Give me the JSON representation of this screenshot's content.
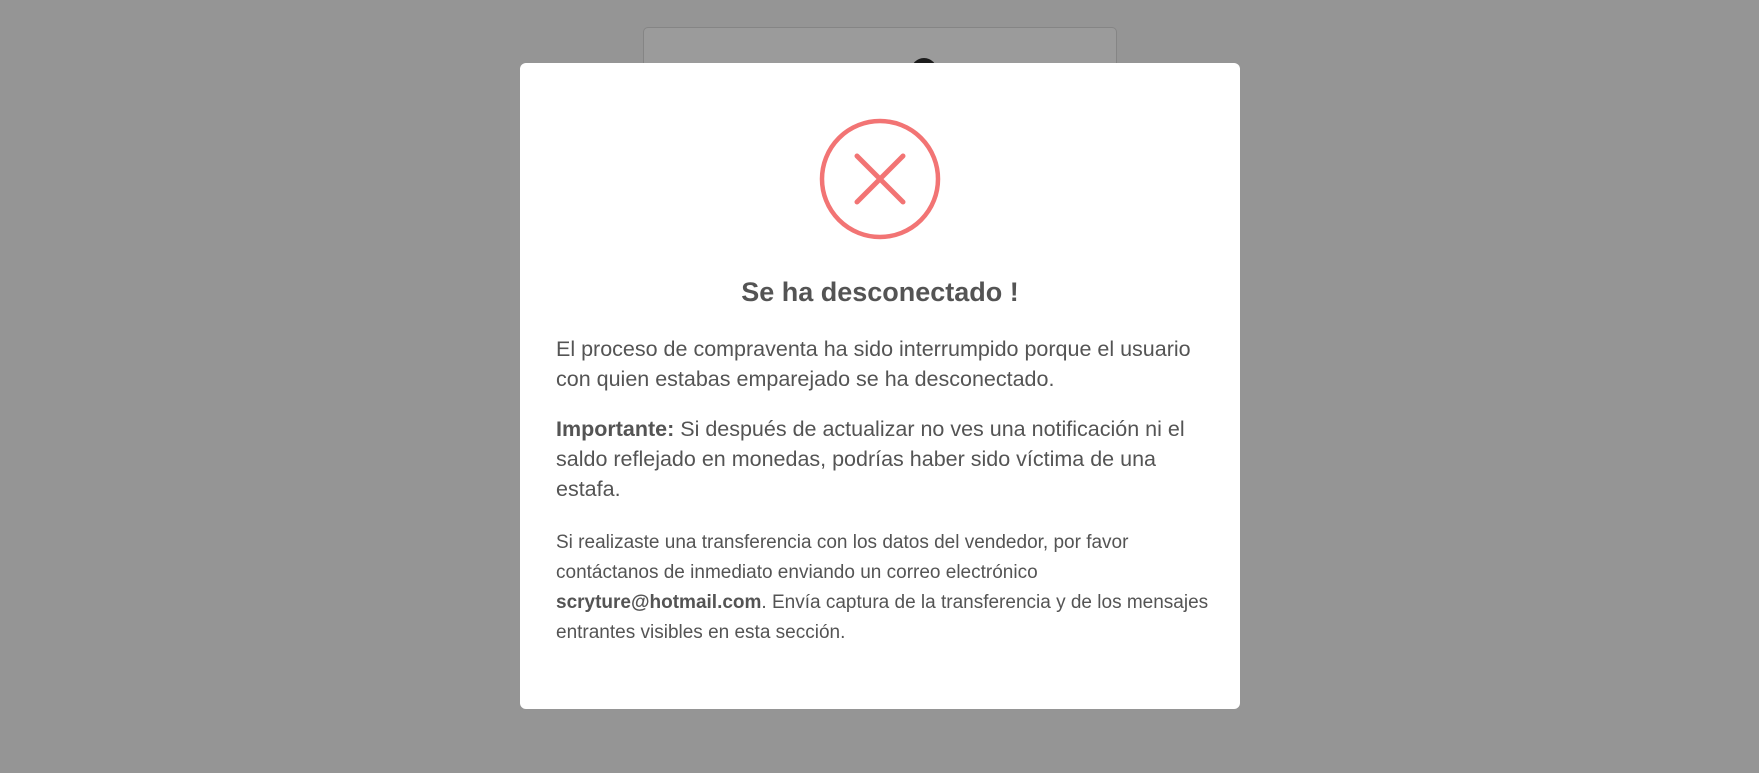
{
  "modal": {
    "icon": "error-x-icon",
    "accent_color": "#f27474",
    "title": "Se ha desconectado !",
    "message": "El proceso de compraventa ha sido interrumpido porque el usuario con quien estabas emparejado se ha desconectado.",
    "important_label": "Importante:",
    "important_text": " Si después de actualizar no ves una notificación ni el saldo reflejado en monedas, podrías haber sido víctima de una estafa.",
    "contact_text_before": "Si realizaste una transferencia con los datos del vendedor, por favor contáctanos de inmediato enviando un correo electrónico ",
    "contact_email": "scryture@hotmail.com",
    "contact_text_after": ". Envía captura de la transferencia y de los mensajes entrantes visibles en esta sección."
  }
}
